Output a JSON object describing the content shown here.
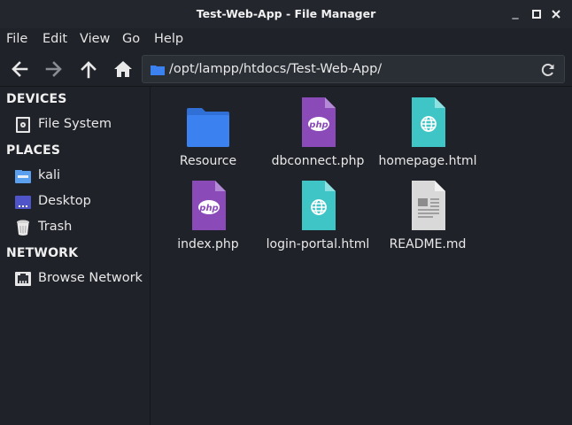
{
  "window": {
    "title": "Test-Web-App - File Manager",
    "controls": {
      "minimize": "_",
      "maximize": "□",
      "close": "✕"
    }
  },
  "menu": [
    "File",
    "Edit",
    "View",
    "Go",
    "Help"
  ],
  "toolbar": {
    "icons": [
      "back-arrow-icon",
      "forward-arrow-icon",
      "up-arrow-icon",
      "home-icon"
    ],
    "path": "/opt/lampp/htdocs/Test-Web-App/"
  },
  "sidebar": {
    "devices_header": "DEVICES",
    "devices": [
      {
        "label": "File System",
        "icon": "drive-icon"
      }
    ],
    "places_header": "PLACES",
    "places": [
      {
        "label": "kali",
        "icon": "home-folder-icon"
      },
      {
        "label": "Desktop",
        "icon": "desktop-icon"
      },
      {
        "label": "Trash",
        "icon": "trash-icon"
      }
    ],
    "network_header": "NETWORK",
    "network": [
      {
        "label": "Browse Network",
        "icon": "network-icon"
      }
    ]
  },
  "files": [
    {
      "name": "Resource",
      "type": "folder"
    },
    {
      "name": "dbconnect.php",
      "type": "php"
    },
    {
      "name": "homepage.html",
      "type": "html"
    },
    {
      "name": "index.php",
      "type": "php"
    },
    {
      "name": "login-portal.html",
      "type": "html"
    },
    {
      "name": "README.md",
      "type": "text"
    }
  ],
  "colors": {
    "folder": "#3b82f0",
    "php": "#8a4bb8",
    "html": "#3fc5c5",
    "text": "#d9d9d9"
  },
  "icon_text": {
    "php": "php"
  }
}
